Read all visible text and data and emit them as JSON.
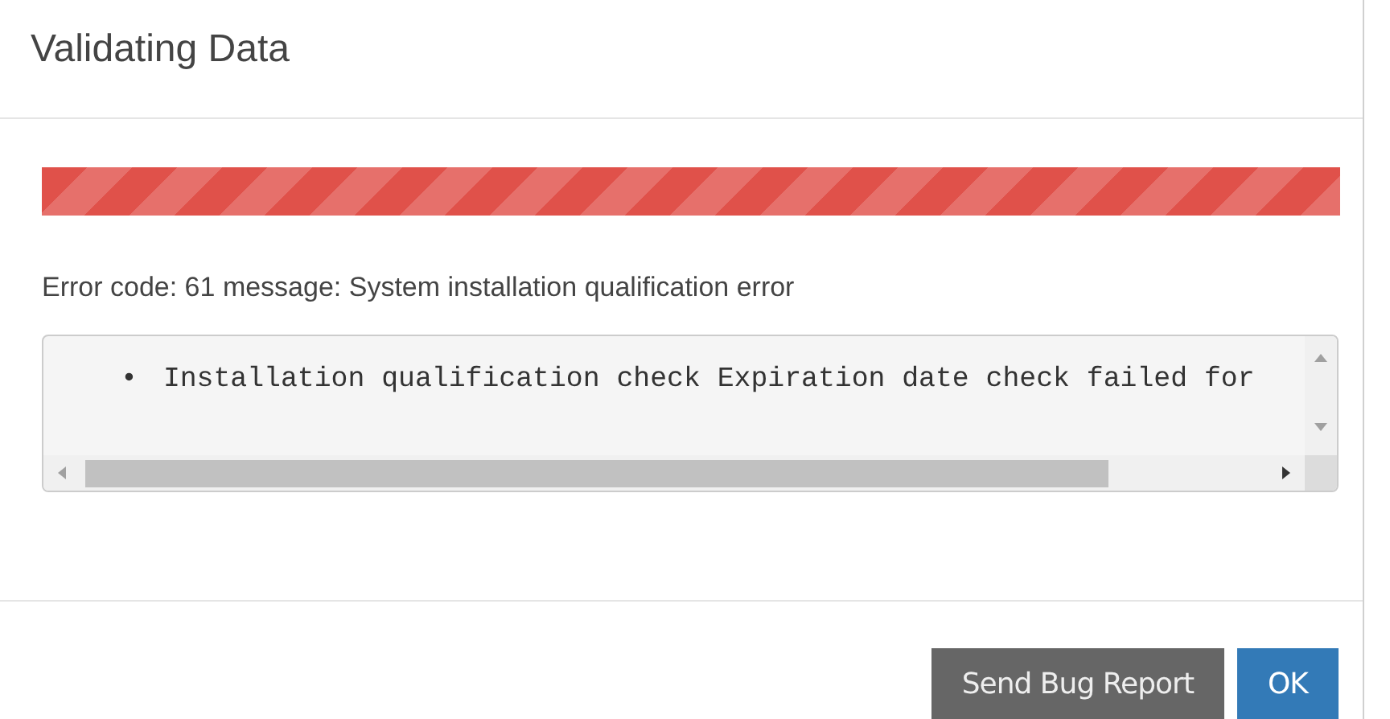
{
  "dialog": {
    "title": "Validating Data"
  },
  "progress": {
    "level": 1,
    "striped": true
  },
  "message": "Error code: 61 message: System installation qualification error",
  "details": {
    "items": [
      {
        "bullet": "•",
        "text": "Installation qualification check Expiration date check failed for"
      }
    ]
  },
  "buttons": [
    {
      "label": "Send Bug Report",
      "kind": "secondary"
    },
    {
      "label": "OK",
      "kind": "primary"
    }
  ]
}
